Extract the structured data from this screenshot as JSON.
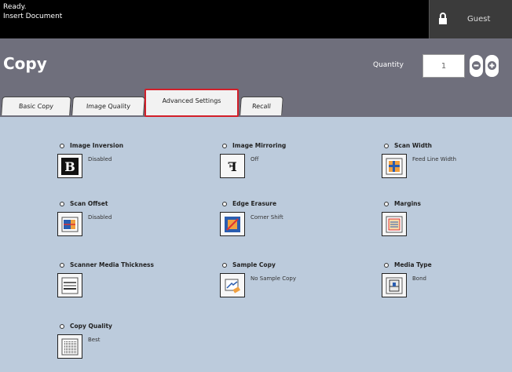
{
  "status": {
    "line1": "Ready.",
    "line2": "Insert Document"
  },
  "guest": {
    "label": "Guest",
    "icon": "lock-icon"
  },
  "header": {
    "title": "Copy",
    "quantity_label": "Quantity",
    "quantity_value": "1",
    "minus_icon": "minus-icon",
    "plus_icon": "plus-icon"
  },
  "tabs": [
    {
      "label": "Basic Copy"
    },
    {
      "label": "Image Quality"
    },
    {
      "label": "Advanced Settings",
      "selected": true
    },
    {
      "label": "Recall"
    }
  ],
  "features": {
    "image_inversion": {
      "label": "Image Inversion",
      "value": "Disabled",
      "icon": "inversion-b-icon"
    },
    "image_mirroring": {
      "label": "Image Mirroring",
      "value": "Off",
      "icon": "mirror-f-icon"
    },
    "scan_width": {
      "label": "Scan Width",
      "value": "Feed Line Width",
      "icon": "scan-width-icon"
    },
    "scan_offset": {
      "label": "Scan Offset",
      "value": "Disabled",
      "icon": "scan-offset-icon"
    },
    "edge_erasure": {
      "label": "Edge Erasure",
      "value": "Corner Shift",
      "icon": "edge-erasure-icon"
    },
    "margins": {
      "label": "Margins",
      "value": "",
      "icon": "margins-icon"
    },
    "scanner_media_thickness": {
      "label": "Scanner Media Thickness",
      "value": "",
      "icon": "media-thickness-icon"
    },
    "sample_copy": {
      "label": "Sample Copy",
      "value": "No Sample Copy",
      "icon": "sample-copy-icon"
    },
    "media_type": {
      "label": "Media Type",
      "value": "Bond",
      "icon": "media-type-icon"
    },
    "copy_quality": {
      "label": "Copy Quality",
      "value": "Best",
      "icon": "copy-quality-icon"
    }
  },
  "colors": {
    "header_bg": "#6f6f7c",
    "content_bg": "#bccbdc",
    "selected_tab_border": "#d21f2a",
    "topbar_bg": "#000000"
  }
}
